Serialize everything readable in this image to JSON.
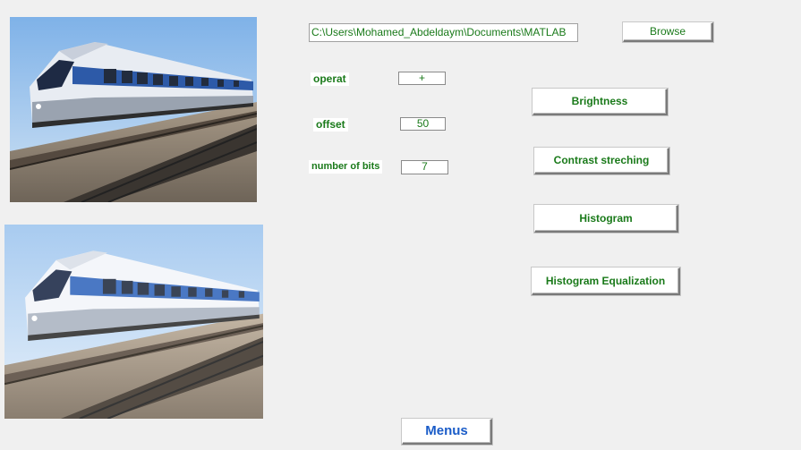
{
  "file": {
    "path_value": "C:\\Users\\Mohamed_Abdeldaym\\Documents\\MATLAB",
    "browse_label": "Browse"
  },
  "params": {
    "operat_label": "operat",
    "operat_value": "+",
    "offset_label": "offset",
    "offset_value": "50",
    "bits_label": "number of bits",
    "bits_value": "7"
  },
  "actions": {
    "brightness": "Brightness",
    "contrast": "Contrast streching",
    "histogram": "Histogram",
    "hist_eq": "Histogram Equalization"
  },
  "footer": {
    "menus_label": "Menus"
  },
  "colors": {
    "text_green": "#1a7a1a",
    "menus_blue": "#1a5cc8",
    "background": "#f0f0f0"
  }
}
